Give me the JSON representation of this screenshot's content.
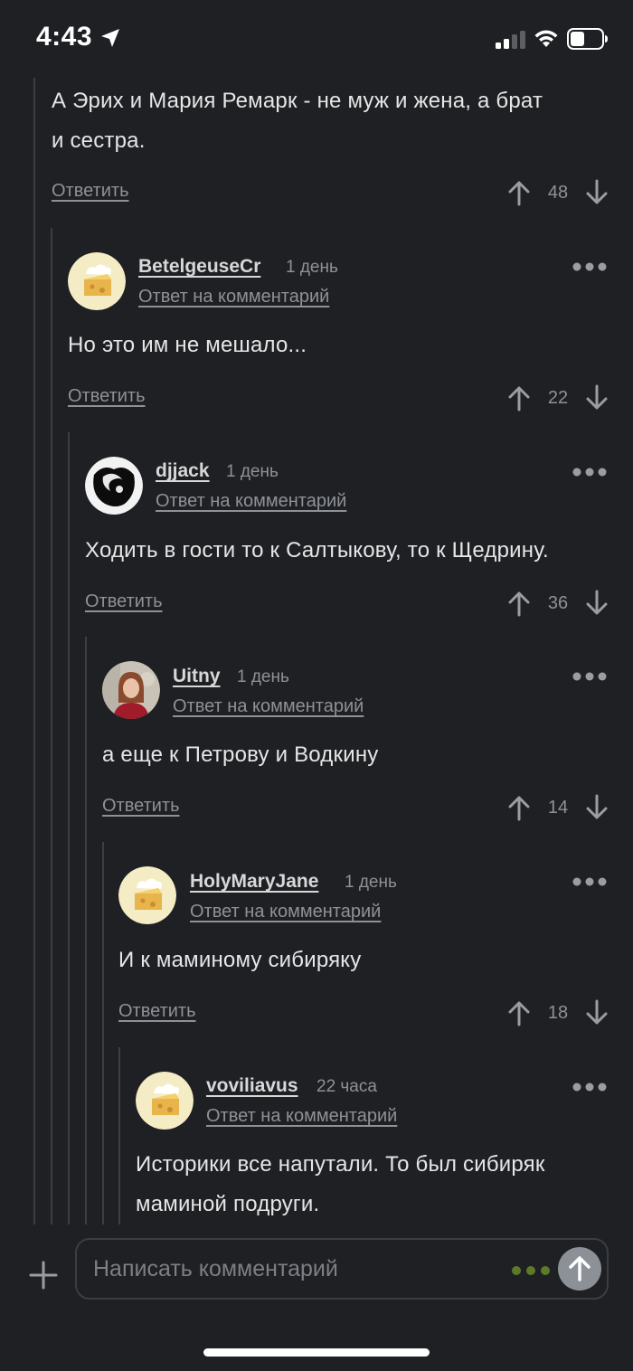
{
  "status_bar": {
    "time": "4:43"
  },
  "top_comment": {
    "text_line1": "А Эрих и Мария Ремарк - не муж и жена, а брат",
    "text_line2": "и сестра.",
    "reply_label": "Ответить",
    "votes": "48"
  },
  "comments": [
    {
      "username": "BetelgeuseCr",
      "time": "1 день",
      "reply_to": "Ответ на комментарий",
      "text_line1": "Но это им не мешало...",
      "text_line2": "",
      "reply_label": "Ответить",
      "votes": "22",
      "avatar": "cheese-avatar"
    },
    {
      "username": "djjack",
      "time": "1 день",
      "reply_to": "Ответ на комментарий",
      "text_line1": "Ходить в гости то к Салтыкову, то к Щедрину.",
      "text_line2": "",
      "reply_label": "Ответить",
      "votes": "36",
      "avatar": "dark-avatar"
    },
    {
      "username": "Uitny",
      "time": "1 день",
      "reply_to": "Ответ на комментарий",
      "text_line1": "а еще к Петрову и Водкину",
      "text_line2": "",
      "reply_label": "Ответить",
      "votes": "14",
      "avatar": "photo-avatar"
    },
    {
      "username": "HolyMaryJane",
      "time": "1 день",
      "reply_to": "Ответ на комментарий",
      "text_line1": "И к маминому сибиряку",
      "text_line2": "",
      "reply_label": "Ответить",
      "votes": "18",
      "avatar": "cheese-avatar"
    },
    {
      "username": "voviliavus",
      "time": "22 часа",
      "reply_to": "Ответ на комментарий",
      "text_line1": "Историки все напутали. То был сибиряк",
      "text_line2": "маминой подруги.",
      "avatar": "cheese-avatar"
    }
  ],
  "composer": {
    "placeholder": "Написать комментарий"
  },
  "colors": {
    "background": "#1e2024",
    "muted": "#8e9196",
    "accent_green": "#5d7a2a",
    "send_button": "#8b9196"
  }
}
